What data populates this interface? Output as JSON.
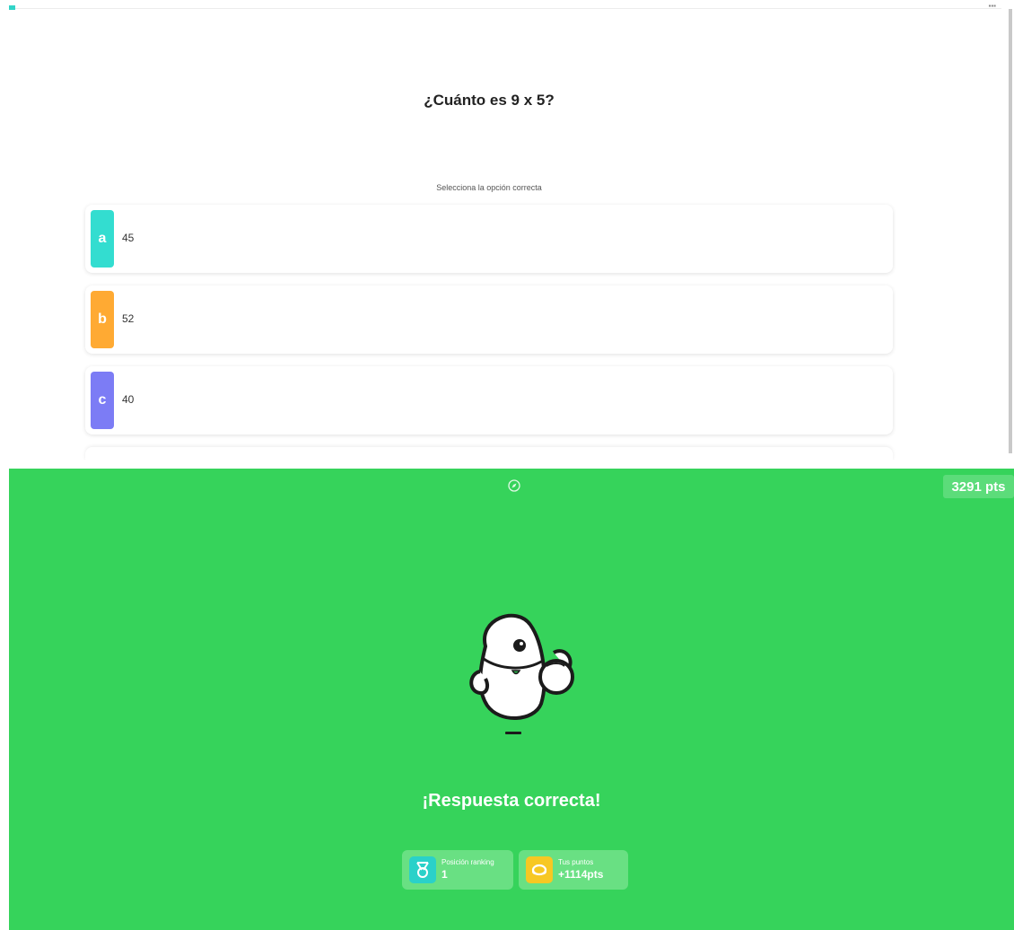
{
  "question_panel": {
    "question": "¿Cuánto es 9 x 5?",
    "instruction": "Selecciona la opción correcta",
    "options": [
      {
        "letter": "a",
        "text": "45",
        "color": "#33ddd0"
      },
      {
        "letter": "b",
        "text": "52",
        "color": "#ffaa33"
      },
      {
        "letter": "c",
        "text": "40",
        "color": "#7c7cf5"
      }
    ]
  },
  "result_panel": {
    "score": "3291 pts",
    "title": "¡Respuesta correcta!",
    "top_icon": "compass-icon",
    "stats": [
      {
        "label": "Posición ranking",
        "value": "1",
        "icon": "medal-icon",
        "icon_color": "#2ad1c9"
      },
      {
        "label": "Tus puntos",
        "value": "+1114pts",
        "icon": "coin-icon",
        "icon_color": "#f7c823"
      }
    ]
  }
}
